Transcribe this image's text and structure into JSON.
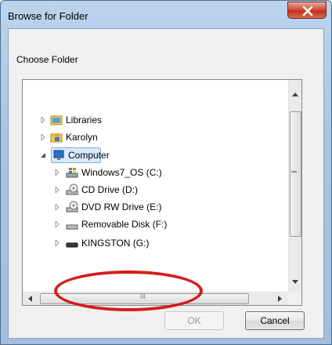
{
  "window": {
    "title": "Browse for Folder",
    "close_icon": "close-icon"
  },
  "dialog": {
    "prompt": "Choose Folder"
  },
  "tree": {
    "items": [
      {
        "label": "Libraries",
        "icon": "libraries-icon",
        "expanded": false
      },
      {
        "label": "Karolyn",
        "icon": "user-folder-icon",
        "expanded": false
      },
      {
        "label": "Computer",
        "icon": "computer-icon",
        "expanded": true,
        "selected": true
      },
      {
        "label": "Windows7_OS (C:)",
        "icon": "windows-drive-icon",
        "expanded": false
      },
      {
        "label": "CD Drive (D:)",
        "icon": "cd-drive-icon",
        "expanded": false
      },
      {
        "label": "DVD RW Drive (E:)",
        "icon": "dvd-drive-icon",
        "expanded": false
      },
      {
        "label": "Removable Disk (F:)",
        "icon": "removable-disk-icon",
        "expanded": false
      },
      {
        "label": "KINGSTON (G:)",
        "icon": "usb-drive-icon",
        "expanded": false
      }
    ],
    "scroll_grip": "|||",
    "hscroll_grip": "III"
  },
  "buttons": {
    "ok": "OK",
    "cancel": "Cancel"
  },
  "colors": {
    "highlight_ellipse": "#d31e1e",
    "selection": "#d8eafb"
  }
}
